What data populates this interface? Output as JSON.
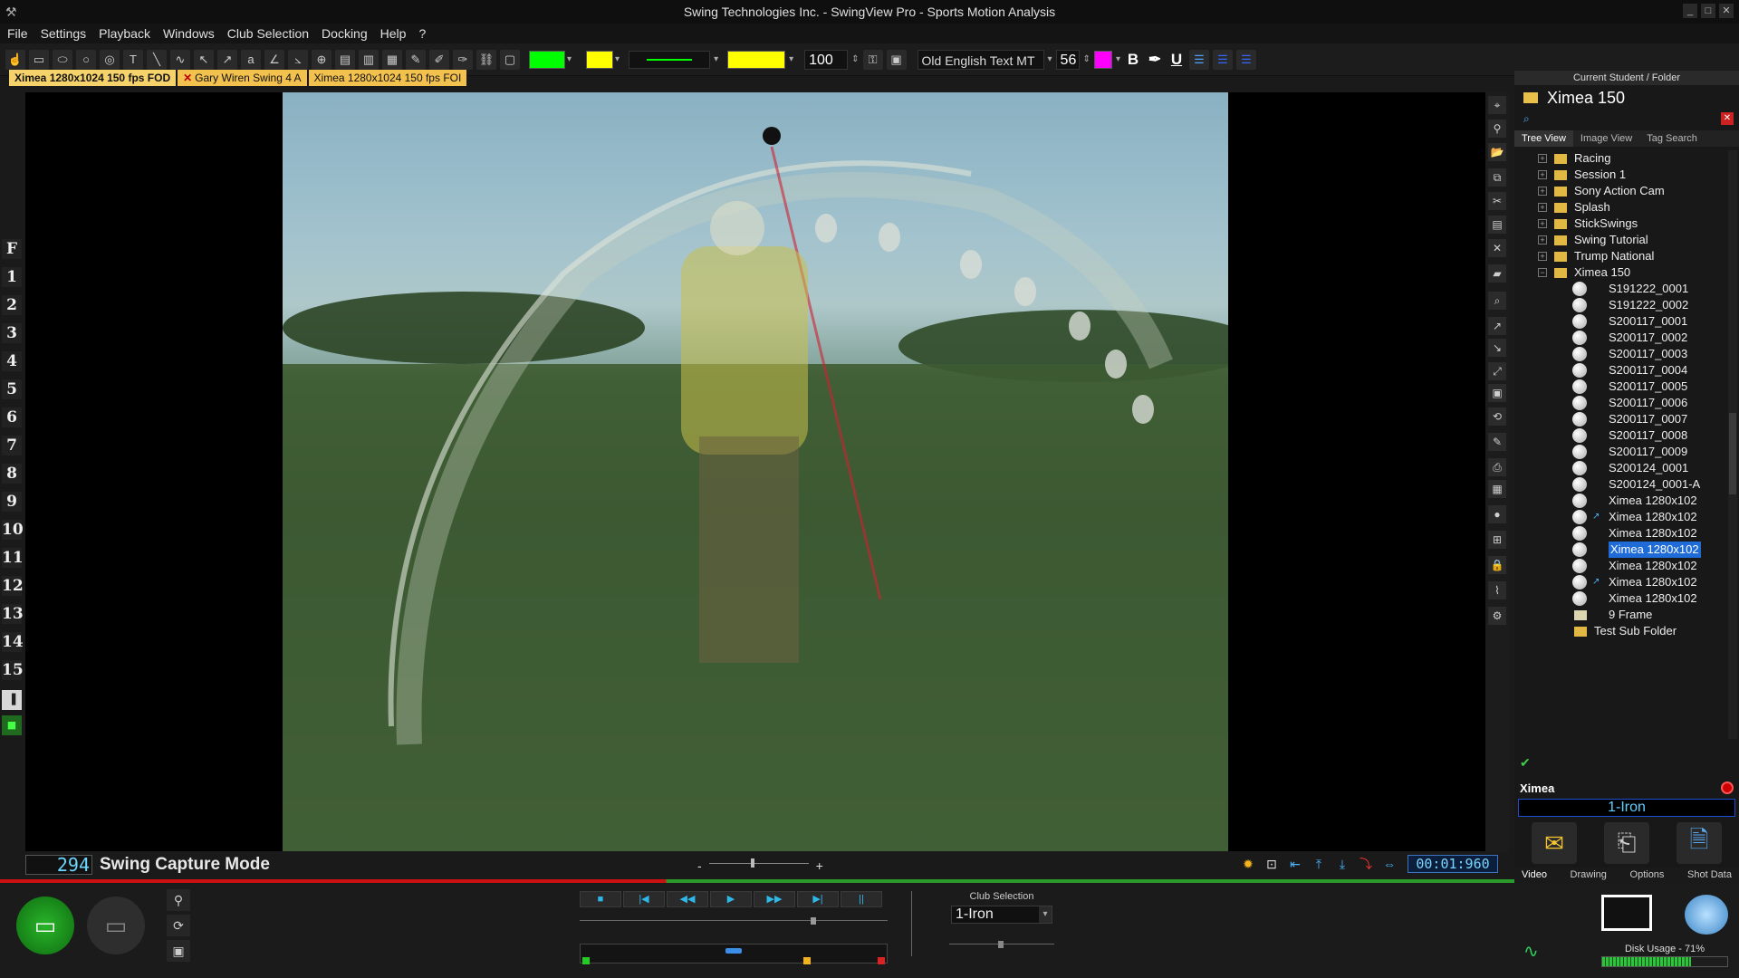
{
  "window": {
    "title": "Swing Technologies Inc. - SwingView Pro - Sports Motion Analysis",
    "controls": [
      "_",
      "□",
      "✕"
    ]
  },
  "menu": [
    "File",
    "Settings",
    "Playback",
    "Windows",
    "Club Selection",
    "Docking",
    "Help",
    "?"
  ],
  "toolbar": {
    "line_color": "#00ff00",
    "fill_color": "#ffff00",
    "wide_fill_color": "#ffff00",
    "opacity_value": "100",
    "font_name": "Old English Text MT",
    "font_size": "56",
    "text_color": "#ff00ff",
    "bold": "B",
    "underline": "U"
  },
  "tabs": [
    {
      "label": "Ximea 1280x1024 150 fps FOD",
      "active": true,
      "closable": false
    },
    {
      "label": "Gary Wiren Swing 4 A",
      "active": false,
      "closable": true
    },
    {
      "label": "Ximea 1280x1024 150 fps FOI",
      "active": false,
      "closable": false
    }
  ],
  "left_labels": [
    "F",
    "1",
    "2",
    "3",
    "4",
    "5",
    "6",
    "7",
    "8",
    "9",
    "10",
    "11",
    "12",
    "13",
    "14",
    "15"
  ],
  "panel": {
    "header": "Current Student / Folder",
    "student": "Ximea 150",
    "tabs": [
      "Tree View",
      "Image View",
      "Tag Search"
    ],
    "folders": [
      "Racing",
      "Session 1",
      "Sony Action Cam",
      "Splash",
      "StickSwings",
      "Swing Tutorial",
      "Trump National",
      "Ximea 150"
    ],
    "files": [
      {
        "label": "S191222_0001",
        "sel": false,
        "tick": false
      },
      {
        "label": "S191222_0002",
        "sel": false,
        "tick": false
      },
      {
        "label": "S200117_0001",
        "sel": false,
        "tick": false
      },
      {
        "label": "S200117_0002",
        "sel": false,
        "tick": false
      },
      {
        "label": "S200117_0003",
        "sel": false,
        "tick": false
      },
      {
        "label": "S200117_0004",
        "sel": false,
        "tick": false
      },
      {
        "label": "S200117_0005",
        "sel": false,
        "tick": false
      },
      {
        "label": "S200117_0006",
        "sel": false,
        "tick": false
      },
      {
        "label": "S200117_0007",
        "sel": false,
        "tick": false
      },
      {
        "label": "S200117_0008",
        "sel": false,
        "tick": false
      },
      {
        "label": "S200117_0009",
        "sel": false,
        "tick": false
      },
      {
        "label": "S200124_0001",
        "sel": false,
        "tick": false
      },
      {
        "label": "S200124_0001-A",
        "sel": false,
        "tick": false
      },
      {
        "label": "Ximea 1280x102",
        "sel": false,
        "tick": false
      },
      {
        "label": "Ximea 1280x102",
        "sel": false,
        "tick": true
      },
      {
        "label": "Ximea 1280x102",
        "sel": false,
        "tick": false
      },
      {
        "label": "Ximea 1280x102",
        "sel": true,
        "tick": false
      },
      {
        "label": "Ximea 1280x102",
        "sel": false,
        "tick": false
      },
      {
        "label": "Ximea 1280x102",
        "sel": false,
        "tick": true
      },
      {
        "label": "Ximea 1280x102",
        "sel": false,
        "tick": false
      }
    ],
    "frame_item": "9 Frame",
    "subfolder": "Test Sub Folder",
    "camera_name": "Ximea",
    "club": "1-Iron",
    "bottom_tabs": [
      "Video",
      "Drawing",
      "Options",
      "Shot Data"
    ]
  },
  "status": {
    "frame": "294",
    "mode": "Swing Capture Mode",
    "zoom_minus": "-",
    "zoom_plus": "+",
    "timer": "00:01:960"
  },
  "bottom": {
    "transport": [
      "■",
      "|◀",
      "◀◀",
      "▶",
      "▶▶",
      "▶|",
      "||"
    ],
    "club_label": "Club Selection",
    "club_value": "1-Iron",
    "disk_label": "Disk Usage - 71%",
    "disk_usage": 0.71
  }
}
